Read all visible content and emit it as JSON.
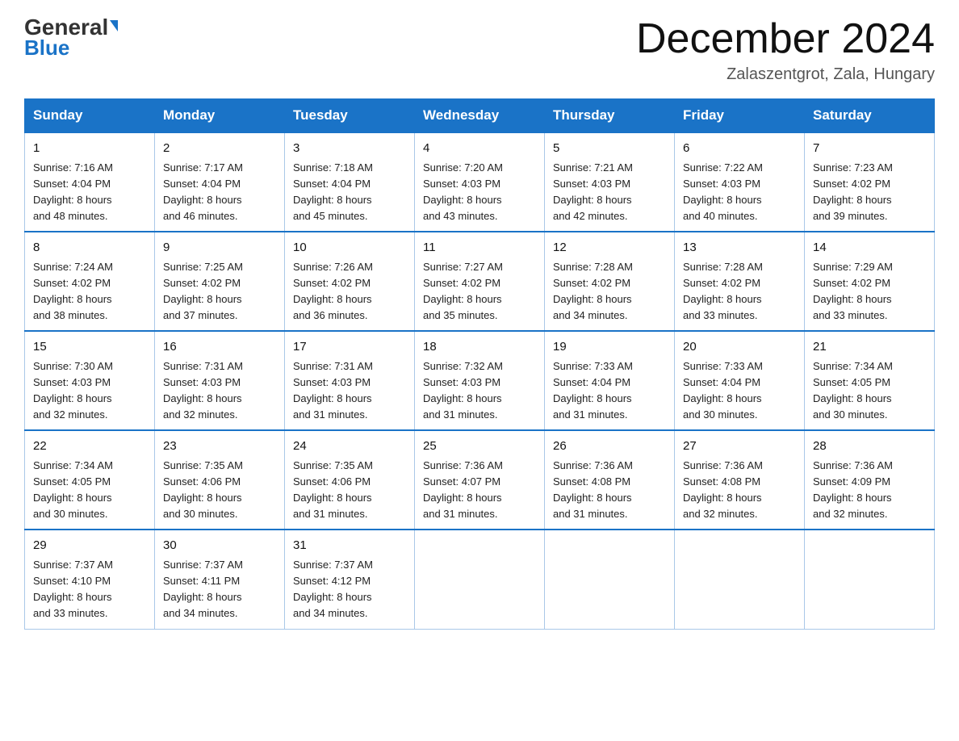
{
  "header": {
    "logo_line1": "General",
    "logo_line2": "Blue",
    "month_title": "December 2024",
    "location": "Zalaszentgrot, Zala, Hungary"
  },
  "weekdays": [
    "Sunday",
    "Monday",
    "Tuesday",
    "Wednesday",
    "Thursday",
    "Friday",
    "Saturday"
  ],
  "weeks": [
    [
      {
        "day": "1",
        "sunrise": "7:16 AM",
        "sunset": "4:04 PM",
        "daylight": "8 hours and 48 minutes."
      },
      {
        "day": "2",
        "sunrise": "7:17 AM",
        "sunset": "4:04 PM",
        "daylight": "8 hours and 46 minutes."
      },
      {
        "day": "3",
        "sunrise": "7:18 AM",
        "sunset": "4:04 PM",
        "daylight": "8 hours and 45 minutes."
      },
      {
        "day": "4",
        "sunrise": "7:20 AM",
        "sunset": "4:03 PM",
        "daylight": "8 hours and 43 minutes."
      },
      {
        "day": "5",
        "sunrise": "7:21 AM",
        "sunset": "4:03 PM",
        "daylight": "8 hours and 42 minutes."
      },
      {
        "day": "6",
        "sunrise": "7:22 AM",
        "sunset": "4:03 PM",
        "daylight": "8 hours and 40 minutes."
      },
      {
        "day": "7",
        "sunrise": "7:23 AM",
        "sunset": "4:02 PM",
        "daylight": "8 hours and 39 minutes."
      }
    ],
    [
      {
        "day": "8",
        "sunrise": "7:24 AM",
        "sunset": "4:02 PM",
        "daylight": "8 hours and 38 minutes."
      },
      {
        "day": "9",
        "sunrise": "7:25 AM",
        "sunset": "4:02 PM",
        "daylight": "8 hours and 37 minutes."
      },
      {
        "day": "10",
        "sunrise": "7:26 AM",
        "sunset": "4:02 PM",
        "daylight": "8 hours and 36 minutes."
      },
      {
        "day": "11",
        "sunrise": "7:27 AM",
        "sunset": "4:02 PM",
        "daylight": "8 hours and 35 minutes."
      },
      {
        "day": "12",
        "sunrise": "7:28 AM",
        "sunset": "4:02 PM",
        "daylight": "8 hours and 34 minutes."
      },
      {
        "day": "13",
        "sunrise": "7:28 AM",
        "sunset": "4:02 PM",
        "daylight": "8 hours and 33 minutes."
      },
      {
        "day": "14",
        "sunrise": "7:29 AM",
        "sunset": "4:02 PM",
        "daylight": "8 hours and 33 minutes."
      }
    ],
    [
      {
        "day": "15",
        "sunrise": "7:30 AM",
        "sunset": "4:03 PM",
        "daylight": "8 hours and 32 minutes."
      },
      {
        "day": "16",
        "sunrise": "7:31 AM",
        "sunset": "4:03 PM",
        "daylight": "8 hours and 32 minutes."
      },
      {
        "day": "17",
        "sunrise": "7:31 AM",
        "sunset": "4:03 PM",
        "daylight": "8 hours and 31 minutes."
      },
      {
        "day": "18",
        "sunrise": "7:32 AM",
        "sunset": "4:03 PM",
        "daylight": "8 hours and 31 minutes."
      },
      {
        "day": "19",
        "sunrise": "7:33 AM",
        "sunset": "4:04 PM",
        "daylight": "8 hours and 31 minutes."
      },
      {
        "day": "20",
        "sunrise": "7:33 AM",
        "sunset": "4:04 PM",
        "daylight": "8 hours and 30 minutes."
      },
      {
        "day": "21",
        "sunrise": "7:34 AM",
        "sunset": "4:05 PM",
        "daylight": "8 hours and 30 minutes."
      }
    ],
    [
      {
        "day": "22",
        "sunrise": "7:34 AM",
        "sunset": "4:05 PM",
        "daylight": "8 hours and 30 minutes."
      },
      {
        "day": "23",
        "sunrise": "7:35 AM",
        "sunset": "4:06 PM",
        "daylight": "8 hours and 30 minutes."
      },
      {
        "day": "24",
        "sunrise": "7:35 AM",
        "sunset": "4:06 PM",
        "daylight": "8 hours and 31 minutes."
      },
      {
        "day": "25",
        "sunrise": "7:36 AM",
        "sunset": "4:07 PM",
        "daylight": "8 hours and 31 minutes."
      },
      {
        "day": "26",
        "sunrise": "7:36 AM",
        "sunset": "4:08 PM",
        "daylight": "8 hours and 31 minutes."
      },
      {
        "day": "27",
        "sunrise": "7:36 AM",
        "sunset": "4:08 PM",
        "daylight": "8 hours and 32 minutes."
      },
      {
        "day": "28",
        "sunrise": "7:36 AM",
        "sunset": "4:09 PM",
        "daylight": "8 hours and 32 minutes."
      }
    ],
    [
      {
        "day": "29",
        "sunrise": "7:37 AM",
        "sunset": "4:10 PM",
        "daylight": "8 hours and 33 minutes."
      },
      {
        "day": "30",
        "sunrise": "7:37 AM",
        "sunset": "4:11 PM",
        "daylight": "8 hours and 34 minutes."
      },
      {
        "day": "31",
        "sunrise": "7:37 AM",
        "sunset": "4:12 PM",
        "daylight": "8 hours and 34 minutes."
      },
      null,
      null,
      null,
      null
    ]
  ],
  "labels": {
    "sunrise": "Sunrise:",
    "sunset": "Sunset:",
    "daylight": "Daylight:"
  }
}
